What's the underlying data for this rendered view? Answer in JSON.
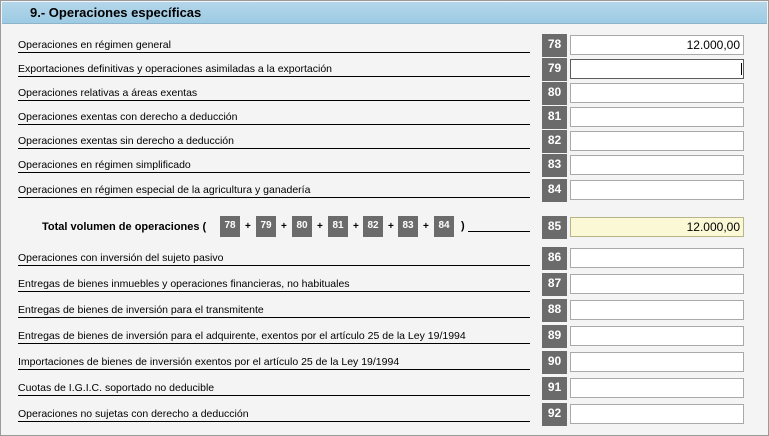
{
  "section": {
    "title": "9.- Operaciones específicas"
  },
  "rows_top": [
    {
      "code": "78",
      "label": "Operaciones en régimen general",
      "value": "12.000,00"
    },
    {
      "code": "79",
      "label": "Exportaciones definitivas y operaciones asimiladas a la exportación",
      "value": ""
    },
    {
      "code": "80",
      "label": "Operaciones relativas a áreas exentas",
      "value": ""
    },
    {
      "code": "81",
      "label": "Operaciones exentas con derecho a deducción",
      "value": ""
    },
    {
      "code": "82",
      "label": "Operaciones exentas sin derecho a deducción",
      "value": ""
    },
    {
      "code": "83",
      "label": "Operaciones en régimen simplificado",
      "value": ""
    },
    {
      "code": "84",
      "label": "Operaciones en régimen especial de la agricultura y ganadería",
      "value": ""
    }
  ],
  "total": {
    "label": "Total volumen de operaciones (",
    "close": ")",
    "plus": "+",
    "chips": [
      "78",
      "79",
      "80",
      "81",
      "82",
      "83",
      "84"
    ],
    "code": "85",
    "value": "12.000,00"
  },
  "rows_bottom": [
    {
      "code": "86",
      "label": "Operaciones con inversión del sujeto pasivo",
      "value": ""
    },
    {
      "code": "87",
      "label": "Entregas de bienes inmuebles y operaciones financieras, no habituales",
      "value": ""
    },
    {
      "code": "88",
      "label": "Entregas de bienes de inversión para el transmitente",
      "value": ""
    },
    {
      "code": "89",
      "label": "Entregas de bienes de inversión para el adquirente, exentos por el artículo 25 de la Ley 19/1994",
      "value": ""
    },
    {
      "code": "90",
      "label": "Importaciones de bienes de inversión exentos por el artículo 25 de la Ley 19/1994",
      "value": ""
    },
    {
      "code": "91",
      "label": "Cuotas de I.G.I.C. soportado no deducible",
      "value": ""
    },
    {
      "code": "92",
      "label": "Operaciones no sujetas con derecho a deducción",
      "value": ""
    }
  ]
}
